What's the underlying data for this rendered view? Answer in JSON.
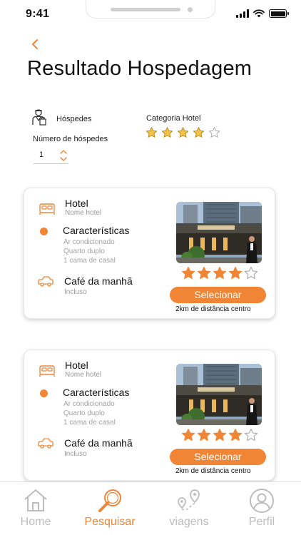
{
  "status_bar": {
    "time": "9:41"
  },
  "header": {
    "title": "Resultado Hospedagem",
    "back_icon": "chevron-left-icon"
  },
  "filters": {
    "guests_label": "Hóspedes",
    "guest_count_label": "Número de hóspedes",
    "guest_count_value": "1",
    "hotel_category_label": "Categoria Hotel",
    "category_rating": 4,
    "category_max": 5
  },
  "results": [
    {
      "type_label": "Hotel",
      "name": "Nome hotel",
      "features_title": "Características",
      "features": [
        "Ar condicionado",
        "Quarto duplo",
        "1 cama de casal"
      ],
      "breakfast_title": "Café da manhã",
      "breakfast_status": "Incluso",
      "rating": 4,
      "rating_max": 5,
      "select_label": "Selecionar",
      "distance": "2km de distância centro"
    },
    {
      "type_label": "Hotel",
      "name": "Nome hotel",
      "features_title": "Características",
      "features": [
        "Ar condicionado",
        "Quarto duplo",
        "1 cama de casal"
      ],
      "breakfast_title": "Café da manhã",
      "breakfast_status": "Incluso",
      "rating": 4,
      "rating_max": 5,
      "select_label": "Selecionar",
      "distance": "2km de distância centro"
    }
  ],
  "bottom_nav": [
    {
      "label": "Home",
      "icon": "home-icon",
      "active": false
    },
    {
      "label": "Pesquisar",
      "icon": "search-icon",
      "active": true
    },
    {
      "label": "viagens",
      "icon": "map-route-icon",
      "active": false
    },
    {
      "label": "Perfil",
      "icon": "profile-icon",
      "active": false
    }
  ],
  "colors": {
    "accent": "#f08536",
    "star_filled": "#f08536",
    "filter_star_filled": "#f2c24a",
    "muted_text": "#9a9a9a",
    "nav_inactive": "#bdbdbd"
  }
}
